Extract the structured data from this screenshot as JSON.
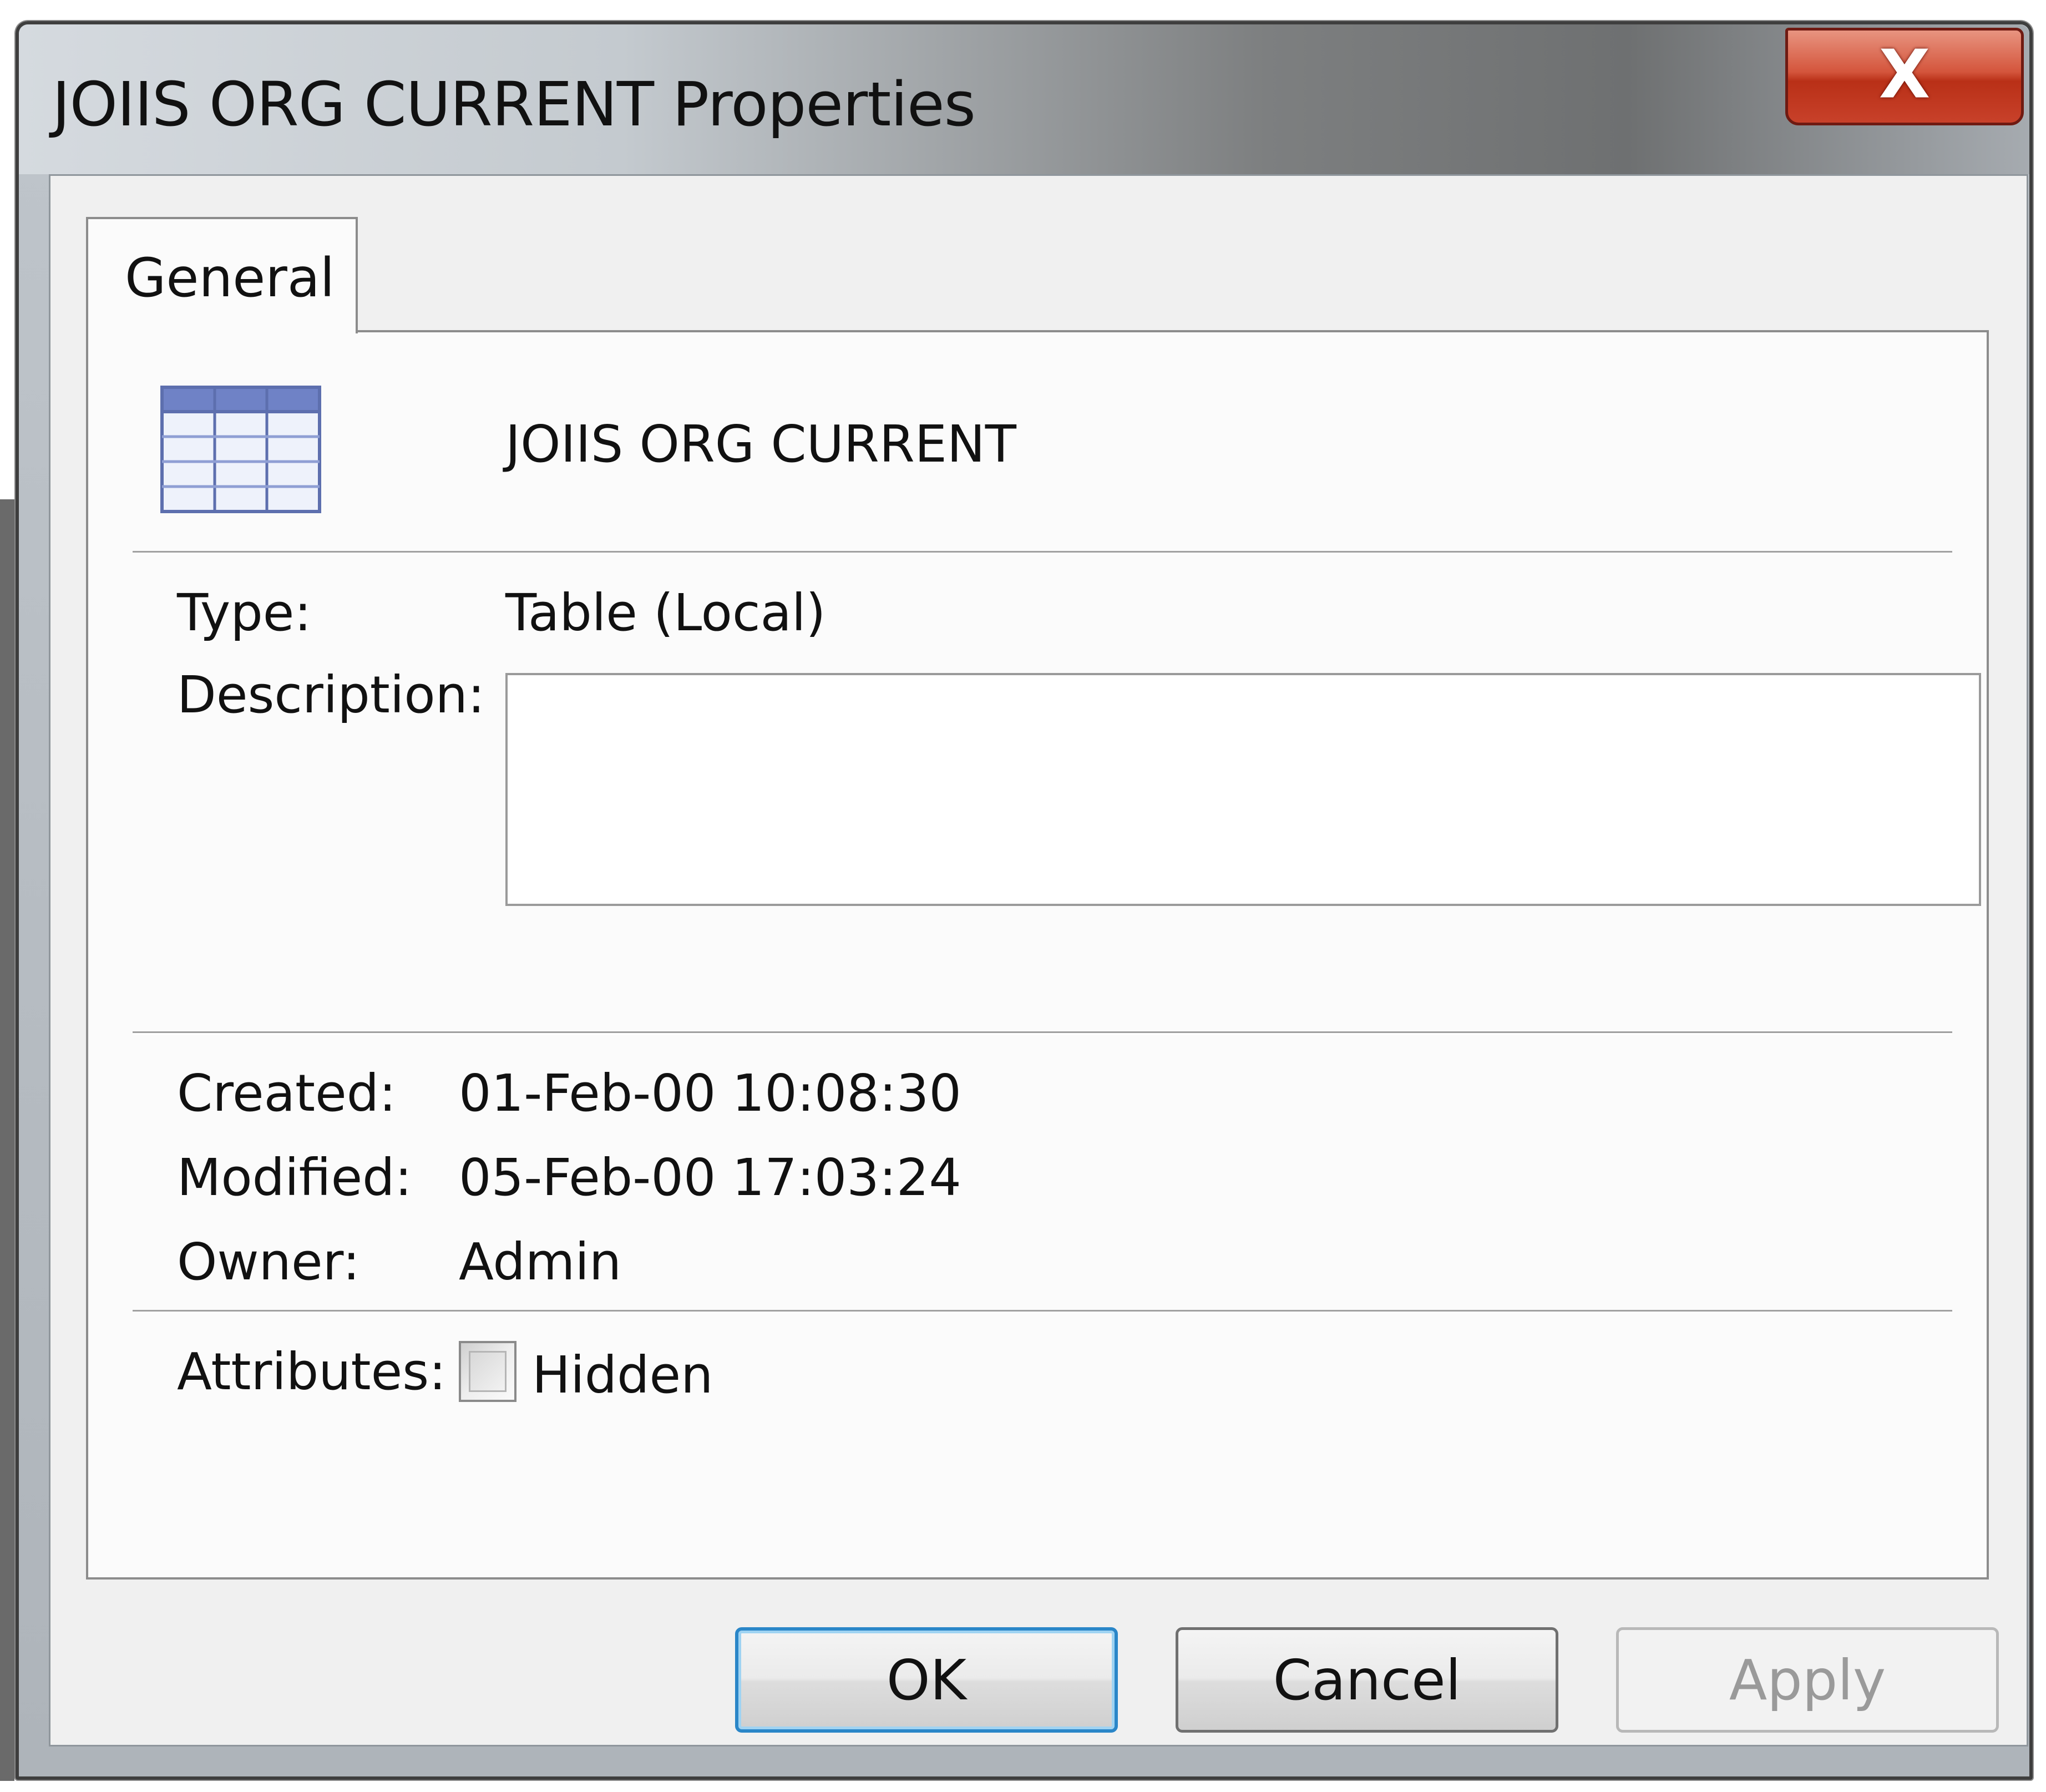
{
  "window": {
    "title": "JOIIS ORG CURRENT Properties",
    "close_glyph": "X"
  },
  "tabs": [
    {
      "label": "General",
      "selected": true
    }
  ],
  "general": {
    "icon": "table-icon",
    "object_name": "JOIIS ORG CURRENT",
    "type_label": "Type:",
    "type_value": "Table (Local)",
    "description_label": "Description:",
    "description_value": "",
    "created_label": "Created:",
    "created_value": "01-Feb-00 10:08:30",
    "modified_label": "Modified:",
    "modified_value": "05-Feb-00 17:03:24",
    "owner_label": "Owner:",
    "owner_value": "Admin",
    "attributes_label": "Attributes:",
    "hidden_label": "Hidden",
    "hidden_checked": false
  },
  "buttons": {
    "ok": "OK",
    "cancel": "Cancel",
    "apply": "Apply",
    "apply_enabled": false
  },
  "colors": {
    "close_button": "#c8412a",
    "default_button_border": "#2a86c8",
    "icon_header": "#6f82c6"
  }
}
